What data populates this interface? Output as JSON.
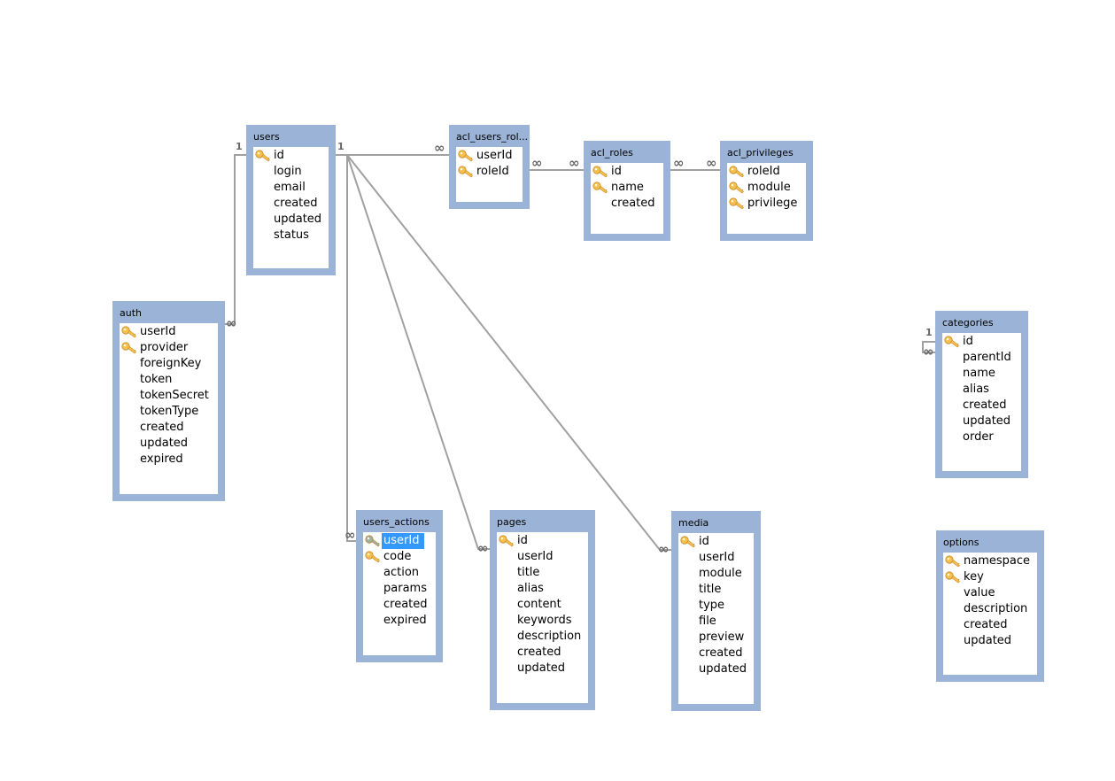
{
  "tables": [
    {
      "name": "users",
      "columns": [
        {
          "n": "id",
          "key": true
        },
        {
          "n": "login"
        },
        {
          "n": "email"
        },
        {
          "n": "created"
        },
        {
          "n": "updated"
        },
        {
          "n": "status"
        }
      ]
    },
    {
      "name": "acl_users_rol...",
      "columns": [
        {
          "n": "userId",
          "key": true
        },
        {
          "n": "roleId",
          "key": true
        }
      ]
    },
    {
      "name": "acl_roles",
      "columns": [
        {
          "n": "id",
          "key": true
        },
        {
          "n": "name",
          "key": true
        },
        {
          "n": "created"
        }
      ]
    },
    {
      "name": "acl_privileges",
      "columns": [
        {
          "n": "roleId",
          "key": true
        },
        {
          "n": "module",
          "key": true
        },
        {
          "n": "privilege",
          "key": true
        }
      ]
    },
    {
      "name": "auth",
      "columns": [
        {
          "n": "userId",
          "key": true
        },
        {
          "n": "provider",
          "key": true
        },
        {
          "n": "foreignKey"
        },
        {
          "n": "token"
        },
        {
          "n": "tokenSecret"
        },
        {
          "n": "tokenType"
        },
        {
          "n": "created"
        },
        {
          "n": "updated"
        },
        {
          "n": "expired"
        }
      ]
    },
    {
      "name": "categories",
      "columns": [
        {
          "n": "id",
          "key": true
        },
        {
          "n": "parentId"
        },
        {
          "n": "name"
        },
        {
          "n": "alias"
        },
        {
          "n": "created"
        },
        {
          "n": "updated"
        },
        {
          "n": "order"
        }
      ]
    },
    {
      "name": "users_actions",
      "columns": [
        {
          "n": "userId",
          "key": true,
          "selected": true
        },
        {
          "n": "code",
          "key": true
        },
        {
          "n": "action"
        },
        {
          "n": "params"
        },
        {
          "n": "created"
        },
        {
          "n": "expired"
        }
      ]
    },
    {
      "name": "pages",
      "columns": [
        {
          "n": "id",
          "key": true
        },
        {
          "n": "userId"
        },
        {
          "n": "title"
        },
        {
          "n": "alias"
        },
        {
          "n": "content"
        },
        {
          "n": "keywords"
        },
        {
          "n": "description"
        },
        {
          "n": "created"
        },
        {
          "n": "updated"
        }
      ]
    },
    {
      "name": "media",
      "columns": [
        {
          "n": "id",
          "key": true
        },
        {
          "n": "userId"
        },
        {
          "n": "module"
        },
        {
          "n": "title"
        },
        {
          "n": "type"
        },
        {
          "n": "file"
        },
        {
          "n": "preview"
        },
        {
          "n": "created"
        },
        {
          "n": "updated"
        }
      ]
    },
    {
      "name": "options",
      "columns": [
        {
          "n": "namespace",
          "key": true
        },
        {
          "n": "key",
          "key": true
        },
        {
          "n": "value"
        },
        {
          "n": "description"
        },
        {
          "n": "created"
        },
        {
          "n": "updated"
        }
      ]
    }
  ],
  "relationships": [
    {
      "from": "users",
      "to": "acl_users_rol...",
      "one": "1",
      "many": "∞"
    },
    {
      "from": "acl_roles",
      "to": "acl_users_rol...",
      "many_a": "∞",
      "many_b": "∞"
    },
    {
      "from": "acl_roles",
      "to": "acl_privileges",
      "many_a": "∞",
      "many_b": "∞"
    },
    {
      "from": "users",
      "to": "auth",
      "one": "1",
      "many": "∞"
    },
    {
      "from": "users",
      "to": "users_actions",
      "many": "∞"
    },
    {
      "from": "users",
      "to": "pages",
      "many": "∞"
    },
    {
      "from": "users",
      "to": "media",
      "many": "∞"
    },
    {
      "from": "categories",
      "to": "categories",
      "one": "1",
      "many": "∞"
    }
  ],
  "colors": {
    "table_frame": "#9bb3d6",
    "selection": "#3399ff",
    "line": "#999999",
    "key": "#f0b840"
  }
}
